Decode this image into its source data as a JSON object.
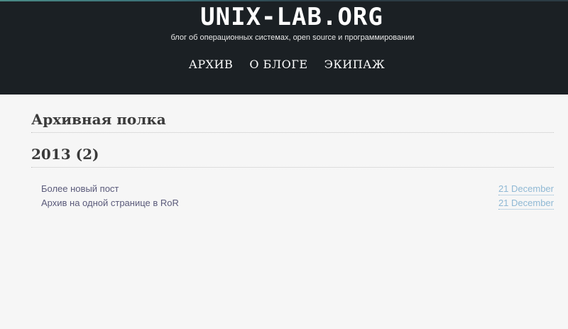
{
  "header": {
    "site_title": "UNIX-LAB.ORG",
    "tagline": "блог об операционных системах, open source и программировании",
    "accent_color": "#1b2024"
  },
  "nav": {
    "items": [
      {
        "label": "АРХИВ"
      },
      {
        "label": "О БЛОГЕ"
      },
      {
        "label": "ЭКИПАЖ"
      }
    ]
  },
  "main": {
    "page_title": "Архивная полка",
    "year_group": {
      "year": "2013",
      "count": "(2)",
      "posts": [
        {
          "title": "Более новый пост",
          "date": "21 December"
        },
        {
          "title": "Архив на одной странице в RoR",
          "date": "21 December"
        }
      ]
    }
  }
}
